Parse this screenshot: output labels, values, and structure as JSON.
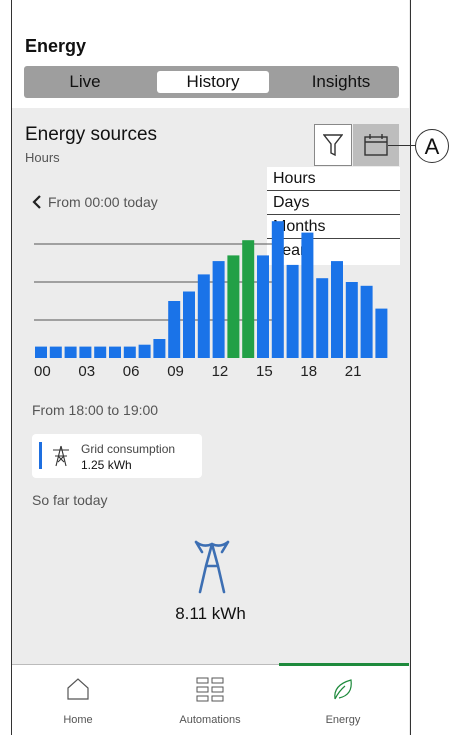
{
  "header": {
    "title": "Energy"
  },
  "tabs": [
    {
      "label": "Live",
      "active": false
    },
    {
      "label": "History",
      "active": true
    },
    {
      "label": "Insights",
      "active": false
    }
  ],
  "section": {
    "title": "Energy sources",
    "subtitle": "Hours"
  },
  "toolbar": {
    "filter_icon": "filter-icon",
    "calendar_icon": "calendar-icon"
  },
  "dropdown": {
    "options": [
      "Hours",
      "Days",
      "Months",
      "Years"
    ]
  },
  "nav_back": {
    "label": "From 00:00 today",
    "icon": "chevron-left-icon"
  },
  "chart_data": {
    "type": "bar",
    "categories": [
      "0",
      "1",
      "2",
      "3",
      "4",
      "5",
      "6",
      "7",
      "8",
      "9",
      "10",
      "11",
      "12",
      "13",
      "14",
      "15",
      "16",
      "17",
      "18",
      "19",
      "20",
      "21",
      "22",
      "23"
    ],
    "values": [
      0.3,
      0.3,
      0.3,
      0.3,
      0.3,
      0.3,
      0.3,
      0.35,
      0.5,
      1.5,
      1.75,
      2.2,
      2.55,
      2.7,
      3.1,
      2.7,
      3.6,
      2.45,
      3.3,
      2.1,
      2.55,
      2.0,
      1.9,
      1.3
    ],
    "colors": [
      "#1a73e8",
      "#1a73e8",
      "#1a73e8",
      "#1a73e8",
      "#1a73e8",
      "#1a73e8",
      "#1a73e8",
      "#1a73e8",
      "#1a73e8",
      "#1a73e8",
      "#1a73e8",
      "#1a73e8",
      "#1a73e8",
      "#22a046",
      "#22a046",
      "#1a73e8",
      "#1a73e8",
      "#1a73e8",
      "#1a73e8",
      "#1a73e8",
      "#1a73e8",
      "#1a73e8",
      "#1a73e8",
      "#1a73e8"
    ],
    "xticks": [
      "00",
      "03",
      "06",
      "09",
      "12",
      "15",
      "18",
      "21"
    ],
    "grid": true
  },
  "selection": {
    "range_label": "From 18:00 to 19:00"
  },
  "card": {
    "label": "Grid consumption",
    "value": "1.25 kWh",
    "icon": "grid-tower-icon",
    "accent": "#1e6fe0"
  },
  "summary": {
    "label": "So far today",
    "total": "8.11 kWh",
    "icon": "grid-tower-icon"
  },
  "navbar": {
    "items": [
      {
        "label": "Home",
        "icon": "home-icon"
      },
      {
        "label": "Automations",
        "icon": "automations-grid-icon"
      },
      {
        "label": "Energy",
        "icon": "leaf-icon",
        "active": true
      }
    ],
    "active_color": "#1e8a3c"
  },
  "callout": {
    "label": "A"
  }
}
